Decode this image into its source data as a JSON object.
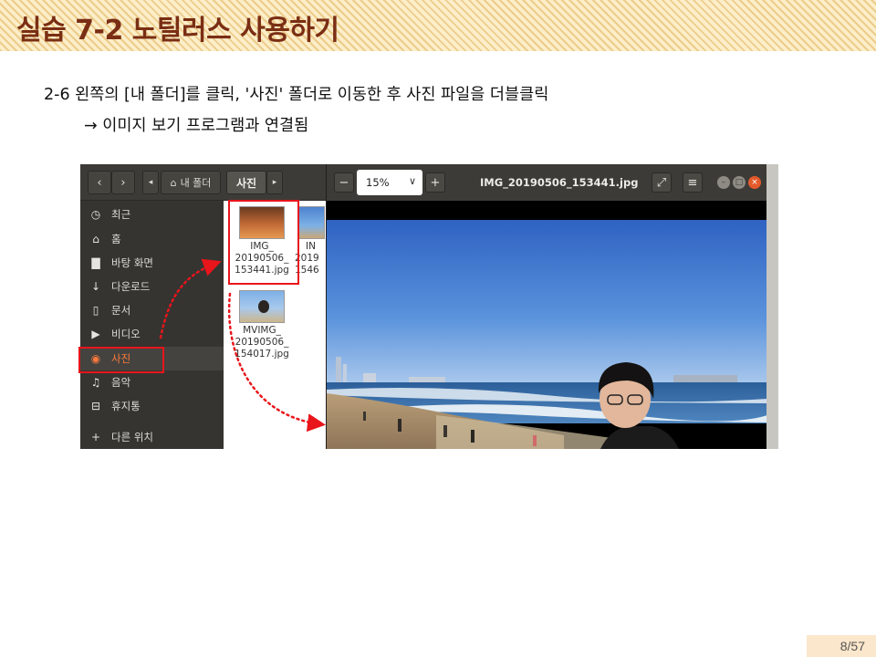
{
  "slide": {
    "title": "실습 7-2 노틸러스 사용하기",
    "step_text": "2-6 왼쪽의 [내 폴더]를 클릭, '사진' 폴더로 이동한 후 사진 파일을 더블클릭",
    "result_text": "→ 이미지 보기 프로그램과 연결됨",
    "page_number": "8/57"
  },
  "file_manager": {
    "nav": {
      "back": "‹",
      "forward": "›",
      "crumb_left": "◂",
      "crumb_right": "▸"
    },
    "breadcrumb": {
      "home_label": "내 폴더",
      "current_label": "사진"
    },
    "sidebar": [
      {
        "label": "최근",
        "icon": "clock-icon",
        "glyph": "◷"
      },
      {
        "label": "홈",
        "icon": "home-icon",
        "glyph": "⌂"
      },
      {
        "label": "바탕 화면",
        "icon": "folder-icon",
        "glyph": "▇"
      },
      {
        "label": "다운로드",
        "icon": "download-icon",
        "glyph": "↓"
      },
      {
        "label": "문서",
        "icon": "document-icon",
        "glyph": "▯"
      },
      {
        "label": "비디오",
        "icon": "video-icon",
        "glyph": "▶"
      },
      {
        "label": "사진",
        "icon": "camera-icon",
        "glyph": "◉"
      },
      {
        "label": "음악",
        "icon": "music-icon",
        "glyph": "♫"
      },
      {
        "label": "휴지통",
        "icon": "trash-icon",
        "glyph": "⊟"
      },
      {
        "label": "다른 위치",
        "icon": "plus-icon",
        "glyph": "+"
      }
    ],
    "files": [
      {
        "name_lines": [
          "IMG_",
          "20190506_",
          "153441.jpg"
        ]
      },
      {
        "name_lines": [
          "MVIMG_",
          "20190506_",
          "154017.jpg"
        ]
      },
      {
        "name_lines": [
          "IN",
          "2019",
          "1546"
        ]
      }
    ]
  },
  "viewer": {
    "zoom_value": "15%",
    "zoom_out": "−",
    "zoom_in": "+",
    "chevron": "∨",
    "title": "IMG_20190506_153441.jpg",
    "fullscreen": "⤢",
    "menu": "≡",
    "min": "–",
    "max": "□",
    "close": "×"
  }
}
